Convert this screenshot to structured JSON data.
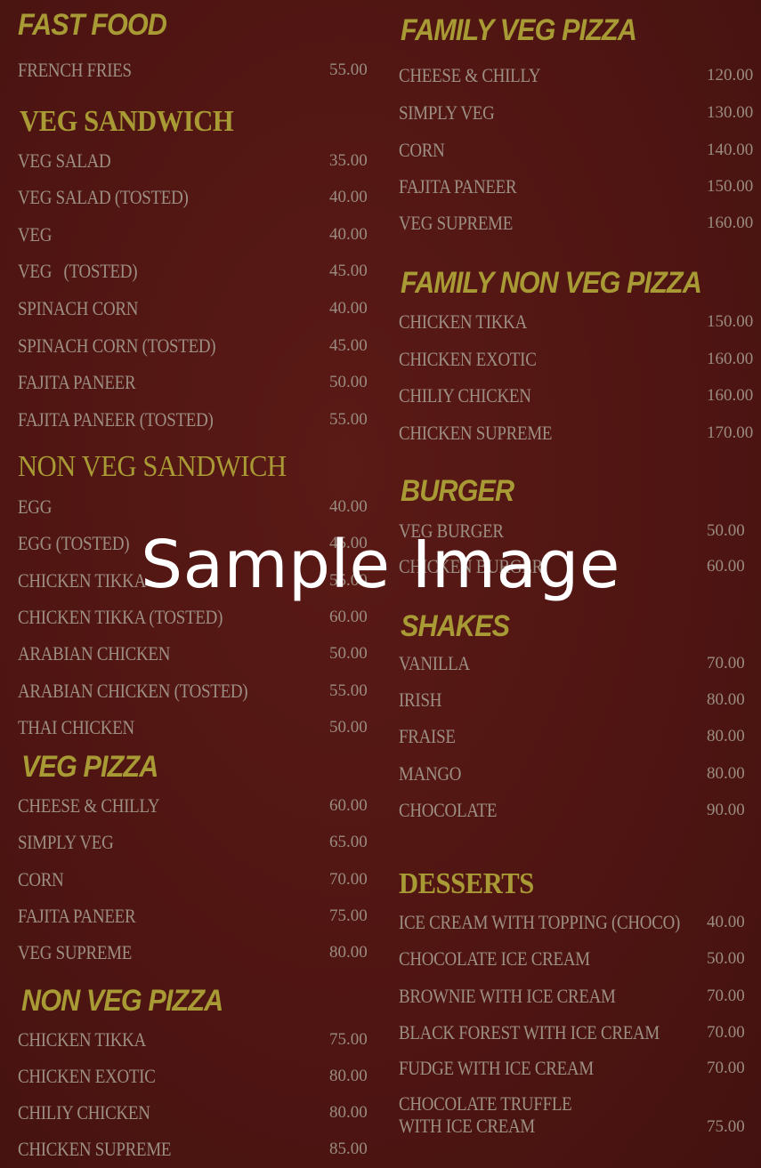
{
  "menu": {
    "left": [
      {
        "heading": "FAST FOOD",
        "style": "sans",
        "items": [
          {
            "name": "FRENCH FRIES",
            "price": "55.00"
          }
        ]
      },
      {
        "heading": "VEG SANDWICH",
        "style": "serif",
        "items": [
          {
            "name": "VEG SALAD",
            "price": "35.00"
          },
          {
            "name": "VEG SALAD (TOSTED)",
            "price": "40.00"
          },
          {
            "name": "VEG",
            "price": "40.00"
          },
          {
            "name": "VEG   (TOSTED)",
            "price": "45.00"
          },
          {
            "name": "SPINACH CORN",
            "price": "40.00"
          },
          {
            "name": "SPINACH CORN (TOSTED)",
            "price": "45.00"
          },
          {
            "name": "FAJITA PANEER",
            "price": "50.00"
          },
          {
            "name": "FAJITA PANEER (TOSTED)",
            "price": "55.00"
          }
        ]
      },
      {
        "heading": "NON VEG SANDWICH",
        "style": "serif",
        "items": [
          {
            "name": "EGG",
            "price": "40.00"
          },
          {
            "name": "EGG (TOSTED)",
            "price": "45.00"
          },
          {
            "name": "CHICKEN TIKKA",
            "price": "55.00"
          },
          {
            "name": "CHICKEN TIKKA (TOSTED)",
            "price": "60.00"
          },
          {
            "name": "ARABIAN CHICKEN",
            "price": "50.00"
          },
          {
            "name": "ARABIAN CHICKEN (TOSTED)",
            "price": "55.00"
          },
          {
            "name": "THAI CHICKEN",
            "price": "50.00"
          }
        ]
      },
      {
        "heading": "VEG PIZZA",
        "style": "sans",
        "items": [
          {
            "name": "CHEESE & CHILLY",
            "price": "60.00"
          },
          {
            "name": "SIMPLY VEG",
            "price": "65.00"
          },
          {
            "name": "CORN",
            "price": "70.00"
          },
          {
            "name": "FAJITA PANEER",
            "price": "75.00"
          },
          {
            "name": "VEG SUPREME",
            "price": "80.00"
          }
        ]
      },
      {
        "heading": "NON VEG PIZZA",
        "style": "sans",
        "items": [
          {
            "name": "CHICKEN TIKKA",
            "price": "75.00"
          },
          {
            "name": "CHICKEN EXOTIC",
            "price": "80.00"
          },
          {
            "name": "CHILIY CHICKEN",
            "price": "80.00"
          },
          {
            "name": "CHICKEN SUPREME",
            "price": "85.00"
          }
        ]
      }
    ],
    "right": [
      {
        "heading": "FAMILY VEG PIZZA",
        "style": "sans",
        "items": [
          {
            "name": "CHEESE & CHILLY",
            "price": "120.00"
          },
          {
            "name": "SIMPLY VEG",
            "price": "130.00"
          },
          {
            "name": "CORN",
            "price": "140.00"
          },
          {
            "name": "FAJITA PANEER",
            "price": "150.00"
          },
          {
            "name": "VEG SUPREME",
            "price": "160.00"
          }
        ]
      },
      {
        "heading": "FAMILY NON VEG PIZZA",
        "style": "sans",
        "items": [
          {
            "name": "CHICKEN TIKKA",
            "price": "150.00"
          },
          {
            "name": "CHICKEN EXOTIC",
            "price": "160.00"
          },
          {
            "name": "CHILIY CHICKEN",
            "price": "160.00"
          },
          {
            "name": "CHICKEN SUPREME",
            "price": "170.00"
          }
        ]
      },
      {
        "heading": "BURGER",
        "style": "sans",
        "items": [
          {
            "name": "VEG BURGER",
            "price": "50.00"
          },
          {
            "name": "CHICKEN BURGER",
            "price": "60.00"
          }
        ]
      },
      {
        "heading": "SHAKES",
        "style": "sans",
        "items": [
          {
            "name": "VANILLA",
            "price": "70.00"
          },
          {
            "name": "IRISH",
            "price": "80.00"
          },
          {
            "name": "FRAISE",
            "price": "80.00"
          },
          {
            "name": "MANGO",
            "price": "80.00"
          },
          {
            "name": "CHOCOLATE",
            "price": "90.00"
          }
        ]
      },
      {
        "heading": "DESSERTS",
        "style": "serif",
        "items": [
          {
            "name": "ICE CREAM WITH TOPPING (CHOCO)",
            "price": "40.00"
          },
          {
            "name": "CHOCOLATE ICE CREAM",
            "price": "50.00"
          },
          {
            "name": "BROWNIE WITH ICE CREAM",
            "price": "70.00"
          },
          {
            "name": "BLACK FOREST WITH ICE CREAM",
            "price": "70.00"
          },
          {
            "name": "FUDGE WITH ICE CREAM",
            "price": "70.00"
          },
          {
            "name": "CHOCOLATE TRUFFLE WITH ICE CREAM",
            "price": "75.00"
          }
        ]
      }
    ]
  },
  "watermark": "Sample Image",
  "colors": {
    "background": "#4f1512",
    "heading": "#a89a34",
    "item_text": "#9e8f84",
    "watermark": "#ffffff"
  }
}
